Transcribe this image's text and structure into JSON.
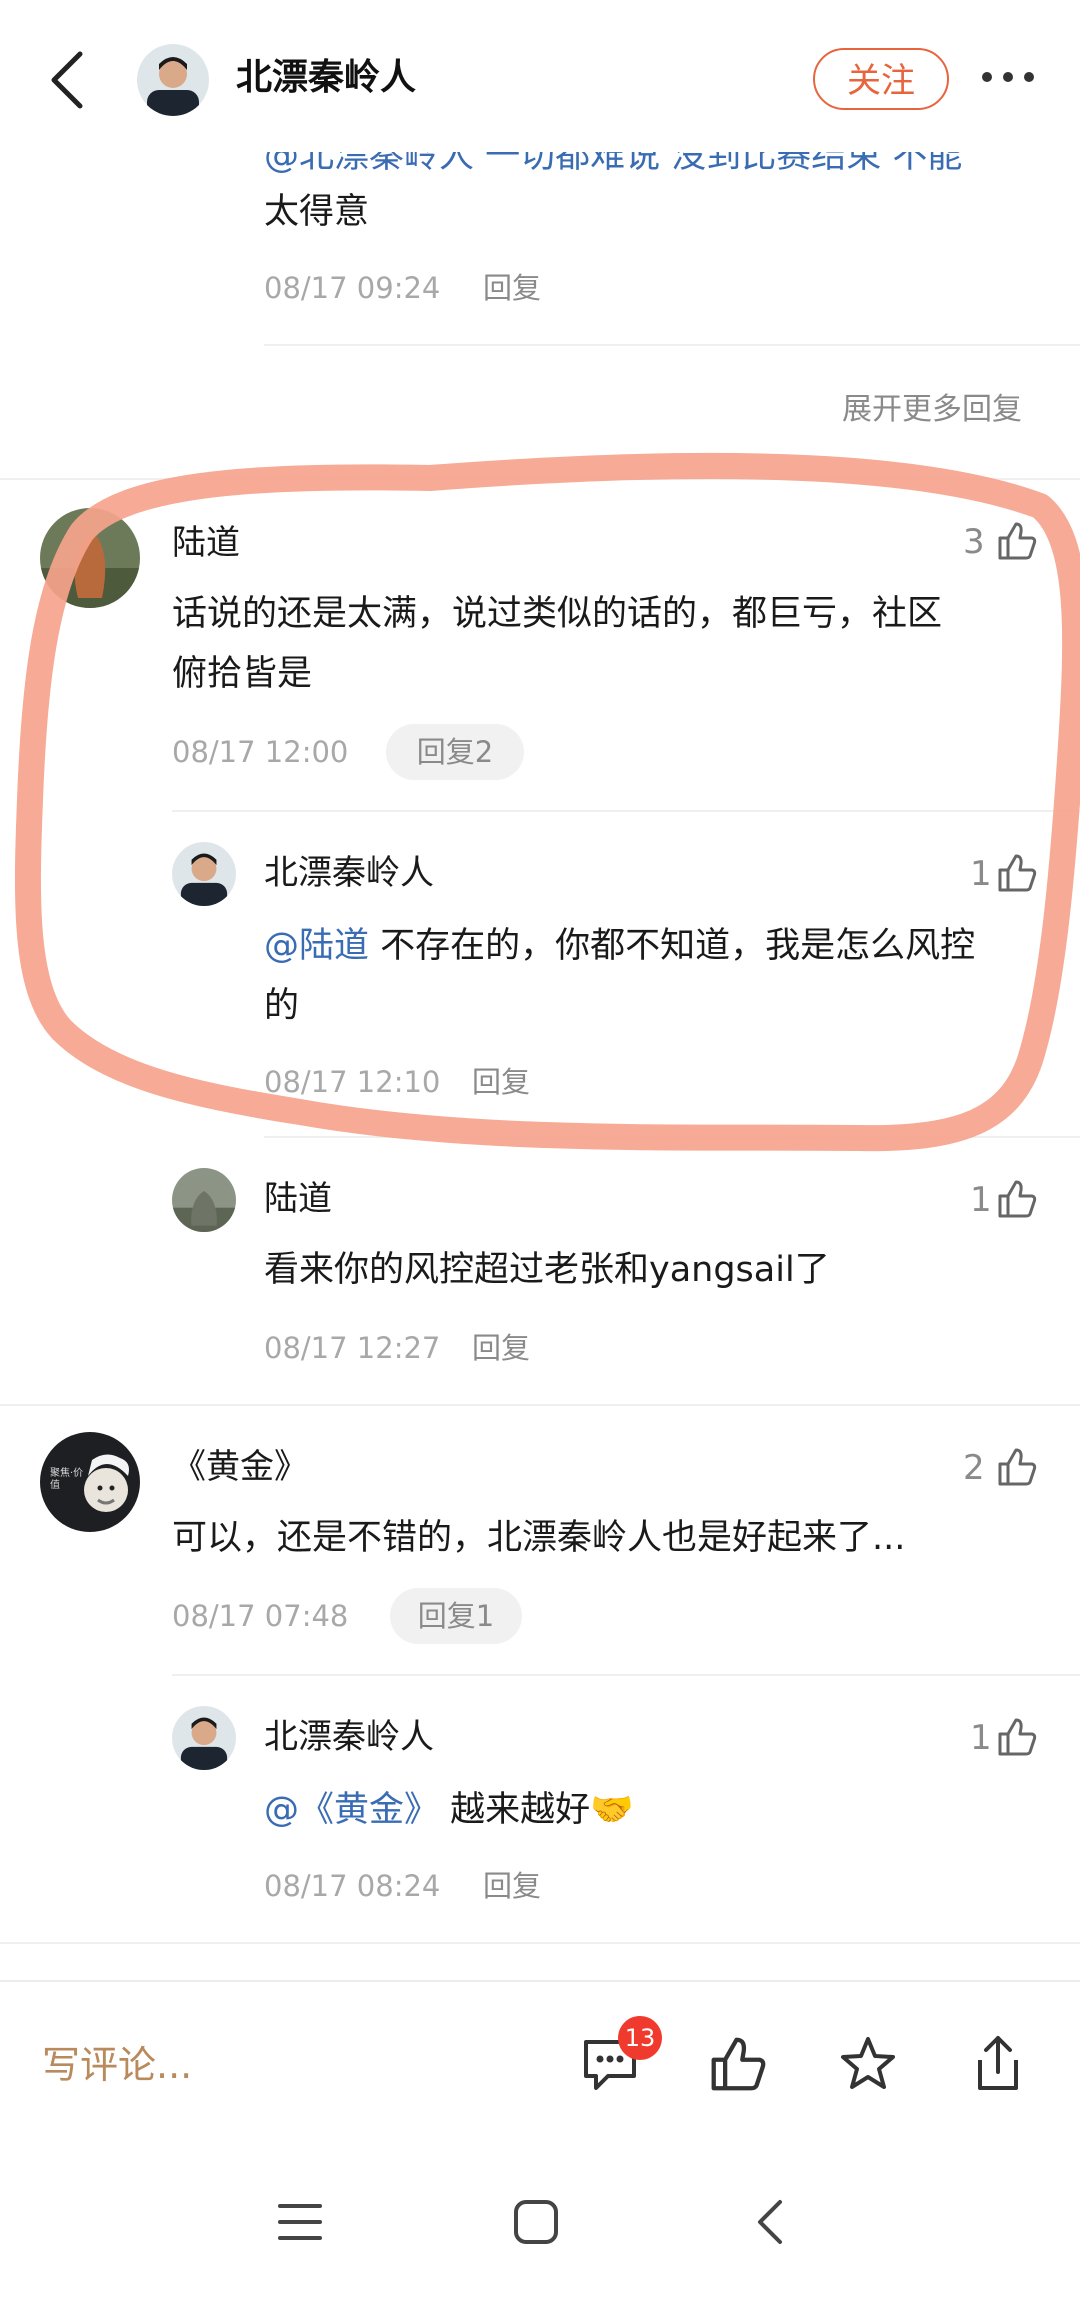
{
  "header": {
    "title": "北漂秦岭人",
    "follow_label": "关注"
  },
  "top_reply": {
    "text_line1": "@北漂秦岭人 一切都难说 没到比赛结束 不能",
    "text_line2": "太得意",
    "time": "08/17 09:24",
    "reply_label": "回复",
    "expand_label": "展开更多回复"
  },
  "comments": [
    {
      "author": "陆道",
      "likes": "3",
      "text_line1": "话说的还是太满，说过类似的话的，都巨亏，社区",
      "text_line2": "俯拾皆是",
      "time": "08/17 12:00",
      "reply_label": "回复2",
      "replies": [
        {
          "author": "北漂秦岭人",
          "likes": "1",
          "mention": "@陆道",
          "text_line1": " 不存在的，你都不知道，我是怎么风控",
          "text_line2": "的",
          "time": "08/17 12:10",
          "reply_label": "回复"
        },
        {
          "author": "陆道",
          "likes": "1",
          "text": "看来你的风控超过老张和yangsail了",
          "time": "08/17 12:27",
          "reply_label": "回复"
        }
      ]
    },
    {
      "author": "《黄金》",
      "likes": "2",
      "text": "可以，还是不错的，北漂秦岭人也是好起来了...",
      "time": "08/17 07:48",
      "reply_label": "回复1",
      "avatar_text": "聚焦·价值",
      "replies": [
        {
          "author": "北漂秦岭人",
          "likes": "1",
          "mention": "@《黄金》",
          "text": " 越来越好🤝",
          "time": "08/17 08:24",
          "reply_label": "回复"
        }
      ]
    }
  ],
  "bottom": {
    "write_placeholder": "写评论...",
    "comment_count": "13"
  },
  "colors": {
    "accent": "#e8643c",
    "mention": "#3a6cb4",
    "highlight_stroke": "#f4a08a",
    "badge": "#f03a2e"
  },
  "icons": [
    "back-icon",
    "more-icon",
    "thumb-up-icon",
    "comment-icon",
    "star-icon",
    "share-icon",
    "menu-icon",
    "home-icon",
    "nav-back-icon"
  ]
}
